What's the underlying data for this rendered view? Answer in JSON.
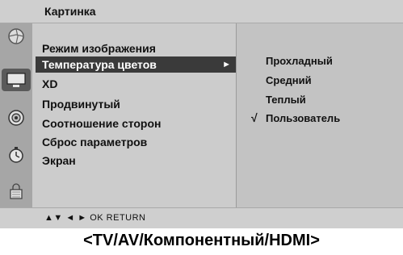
{
  "window": {
    "title": "Картинка"
  },
  "main_menu": {
    "items": [
      {
        "label": "Режим изображения"
      },
      {
        "label": "Температура цветов",
        "selected": true,
        "arrow": "►"
      },
      {
        "label": "XD"
      },
      {
        "label": "Продвинутый"
      },
      {
        "label": "Соотношение сторон"
      },
      {
        "label": "Сброс параметров"
      },
      {
        "label": "Экран"
      }
    ]
  },
  "submenu": {
    "items": [
      {
        "label": "Прохладный"
      },
      {
        "label": "Средний"
      },
      {
        "label": "Теплый"
      },
      {
        "label": "Пользователь",
        "checked": true,
        "check": "√"
      }
    ]
  },
  "bottom_bar": {
    "navigation": "▲▼  ◄ ►  OK  RETURN"
  },
  "caption": "<TV/AV/Компонентный/HDMI>",
  "icons": [
    "picture-wheel-icon",
    "tv-screen-icon",
    "audio-speaker-icon",
    "clock-icon",
    "lock-icon"
  ],
  "colors": {
    "panel_bg": "#cccccc",
    "submenu_bg": "#c3c3c3",
    "selected_bg": "#3a3a3a",
    "selected_text": "#ffffff"
  }
}
